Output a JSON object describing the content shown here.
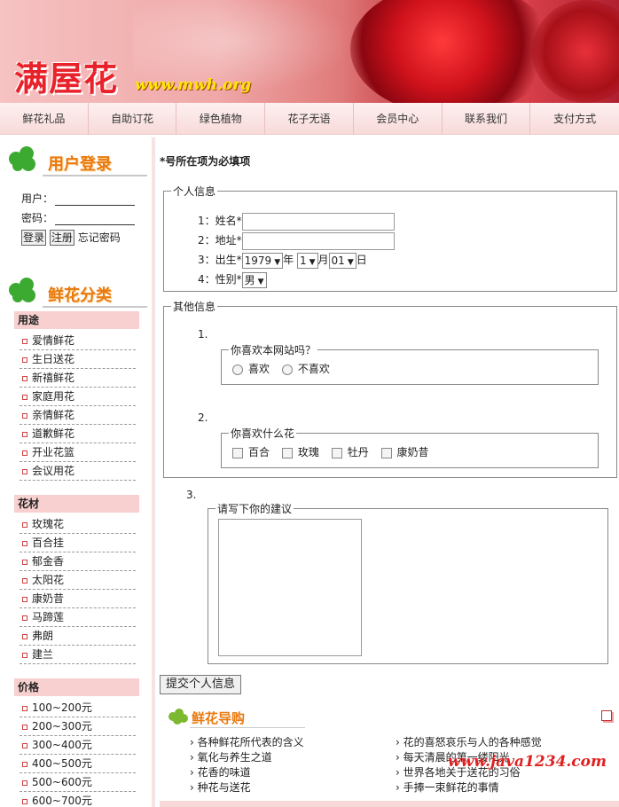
{
  "banner": {
    "logo_text": "满屋花",
    "logo_url": "www.mwh.org"
  },
  "nav": [
    "鲜花礼品",
    "自助订花",
    "绿色植物",
    "花子无语",
    "会员中心",
    "联系我们",
    "支付方式"
  ],
  "login": {
    "title": "用户登录",
    "user_label": "用户：",
    "pass_label": "密码：",
    "login_btn": "登录",
    "register_btn": "注册",
    "forgot": "忘记密码"
  },
  "categories": {
    "title": "鲜花分类",
    "groups": [
      {
        "head": "用途",
        "items": [
          "爱情鲜花",
          "生日送花",
          "新禧鲜花",
          "家庭用花",
          "亲情鲜花",
          "道歉鲜花",
          "开业花篮",
          "会议用花"
        ]
      },
      {
        "head": "花材",
        "items": [
          "玫瑰花",
          "百合挂",
          "郁金香",
          "太阳花",
          "康奶昔",
          "马蹄莲",
          "弗朗",
          "建兰"
        ]
      },
      {
        "head": "价格",
        "items": [
          "100~200元",
          "200~300元",
          "300~400元",
          "400~500元",
          "500~600元",
          "600~700元"
        ]
      }
    ]
  },
  "form": {
    "required_note": "*号所在项为必填项",
    "personal_legend": "个人信息",
    "name_label": "1：姓名*",
    "address_label": "2：地址*",
    "birth_label": "3：出生*",
    "birth_year": "1979",
    "year_unit": "年",
    "birth_month": "1",
    "month_unit": "月",
    "birth_day": "01",
    "day_unit": "日",
    "gender_label": "4：性别*",
    "gender": "男",
    "other_legend": "其他信息",
    "q1_num": "1.",
    "q1_legend": "你喜欢本网站吗？",
    "q1_opts": [
      "喜欢",
      "不喜欢"
    ],
    "q2_num": "2.",
    "q2_legend": "你喜欢什么花",
    "q2_opts": [
      "百合",
      "玫瑰",
      "牡丹",
      "康奶昔"
    ],
    "q3_num": "3.",
    "q3_legend": "请写下你的建议",
    "submit": "提交个人信息"
  },
  "guide": {
    "title": "鲜花导购",
    "left": [
      "各种鲜花所代表的含义",
      "氧化与养生之道",
      "花香的味道",
      "种花与送花"
    ],
    "right": [
      "花的喜怒哀乐与人的各种感觉",
      "每天清晨的第一缕阳光",
      "世界各地关于送花的习俗",
      "手捧一束鲜花的事情"
    ]
  },
  "watermark": "www.java1234.com"
}
